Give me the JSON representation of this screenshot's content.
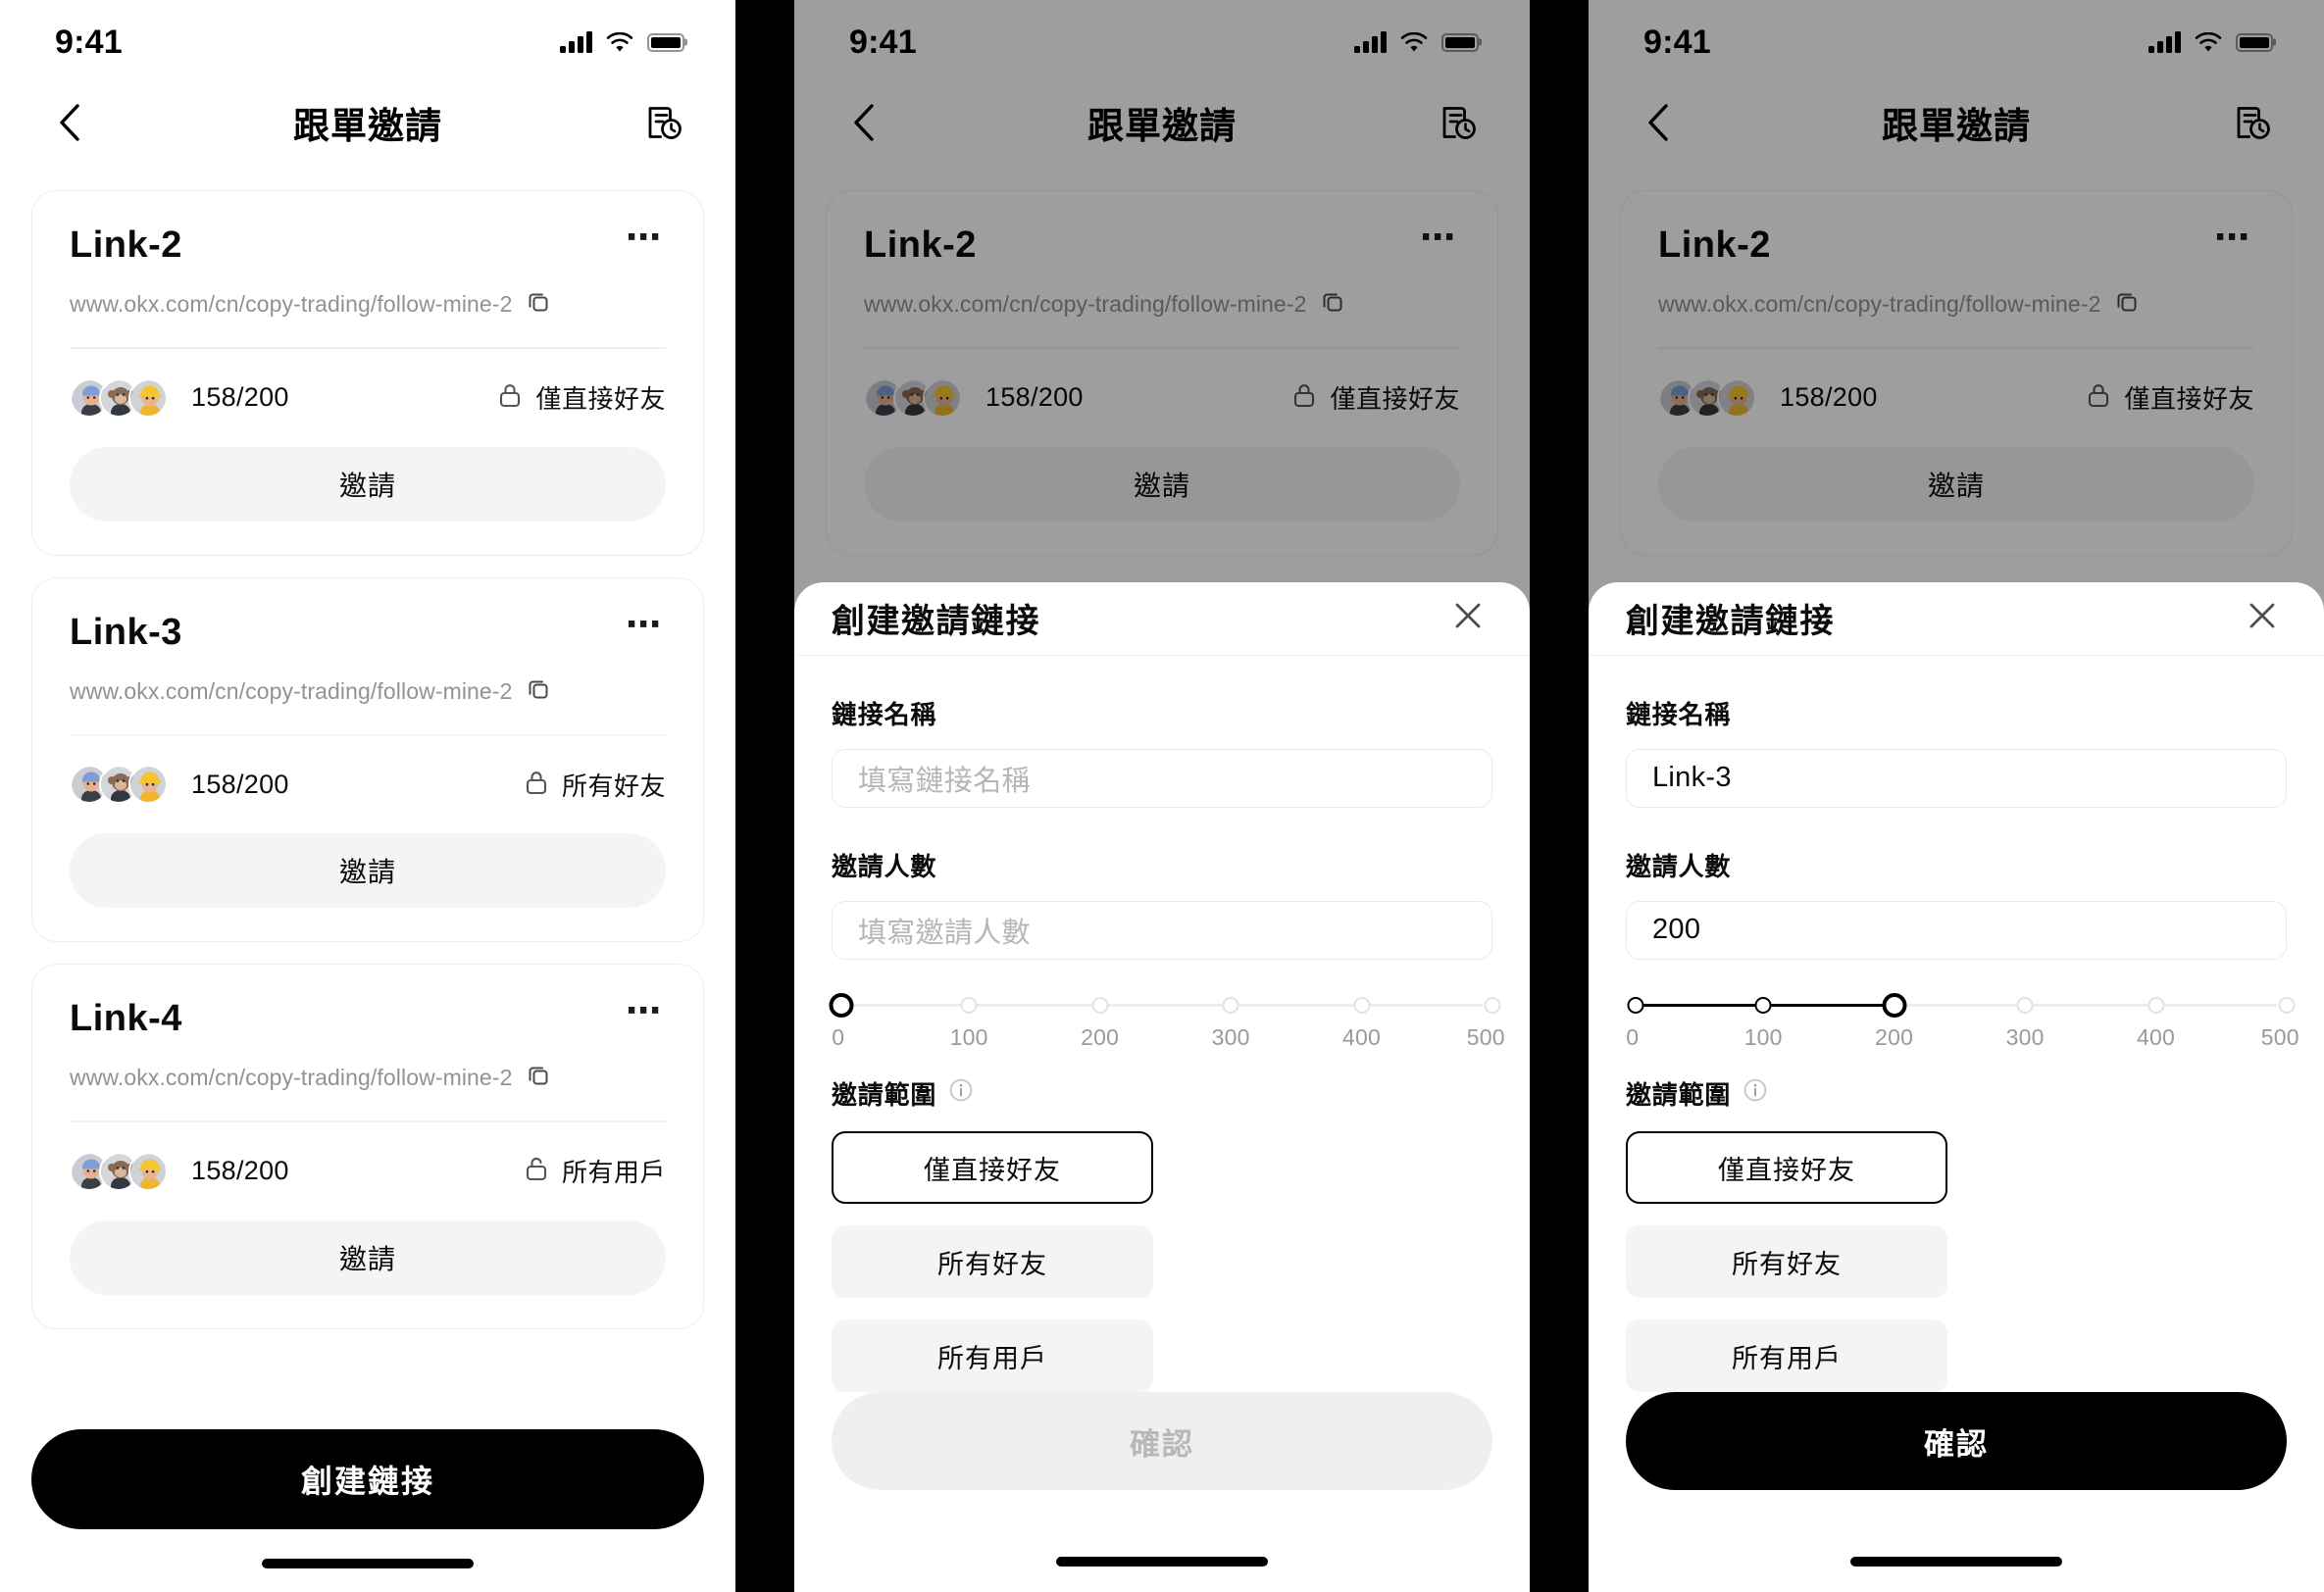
{
  "status_bar": {
    "time": "9:41",
    "signal_icon": "signal-bars-icon",
    "wifi_icon": "wifi-icon",
    "battery_icon": "battery-icon"
  },
  "header": {
    "title": "跟單邀請",
    "back_icon": "chevron-left-icon",
    "history_icon": "document-clock-icon"
  },
  "links": [
    {
      "name": "Link-2",
      "url": "www.okx.com/cn/copy-trading/follow-mine-2",
      "count": "158/200",
      "scope": "僅直接好友",
      "lock_icon": "lock-closed-icon",
      "invite_label": "邀請",
      "more_icon": "more-horizontal-icon",
      "copy_icon": "copy-icon"
    },
    {
      "name": "Link-3",
      "url": "www.okx.com/cn/copy-trading/follow-mine-2",
      "count": "158/200",
      "scope": "所有好友",
      "lock_icon": "lock-closed-icon",
      "invite_label": "邀請",
      "more_icon": "more-horizontal-icon",
      "copy_icon": "copy-icon"
    },
    {
      "name": "Link-4",
      "url": "www.okx.com/cn/copy-trading/follow-mine-2",
      "count": "158/200",
      "scope": "所有用戶",
      "lock_icon": "lock-open-icon",
      "invite_label": "邀請",
      "more_icon": "more-horizontal-icon",
      "copy_icon": "copy-icon"
    }
  ],
  "create_link_button": "創建鏈接",
  "sheet": {
    "title": "創建邀請鏈接",
    "close_icon": "close-icon",
    "name_label": "鏈接名稱",
    "name_placeholder": "填寫鏈接名稱",
    "count_label": "邀請人數",
    "count_placeholder": "填寫邀請人數",
    "scope_label": "邀請範圍",
    "info_icon": "info-circle-icon",
    "scope_options": [
      "僅直接好友",
      "所有好友",
      "所有用戶"
    ],
    "selected_scope": "僅直接好友",
    "confirm_label": "確認",
    "slider": {
      "min": 0,
      "max": 500,
      "step": 100,
      "tick_labels": [
        "0",
        "100",
        "200",
        "300",
        "400",
        "500"
      ]
    }
  },
  "panel2": {
    "name_value": "",
    "count_value": "",
    "slider_value": 0,
    "confirm_enabled": false
  },
  "panel3": {
    "name_value": "Link-3",
    "count_value": "200",
    "slider_value": 200,
    "confirm_enabled": true
  },
  "colors": {
    "accent": "#000000",
    "muted_text": "#929292",
    "chip_bg": "#f3f4f5",
    "disabled_text": "#b8b8b8"
  }
}
